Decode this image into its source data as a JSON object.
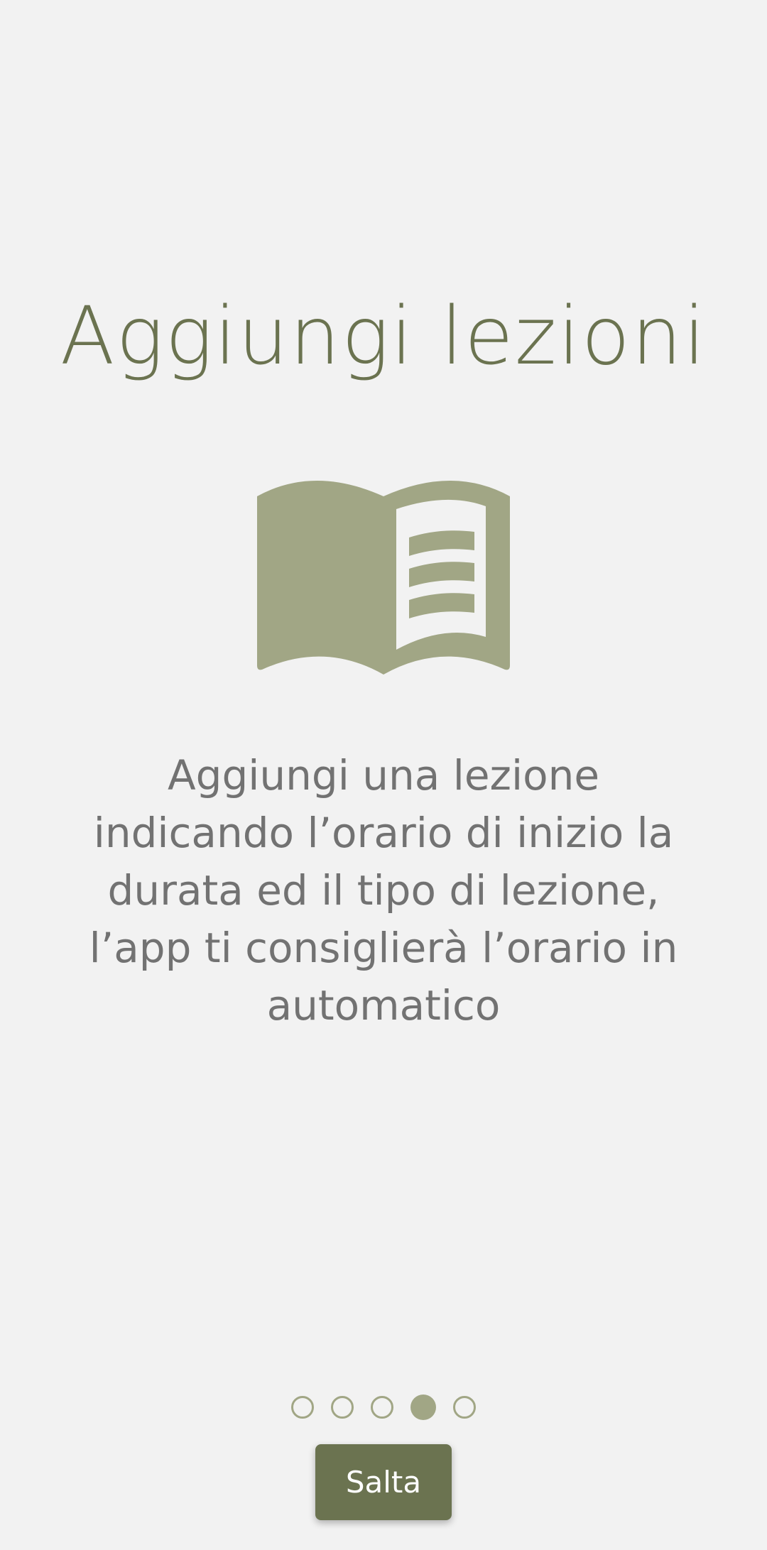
{
  "onboarding": {
    "title": "Aggiungi lezioni",
    "icon": "open-book-icon",
    "description": "Aggiungi una lezione indicando l’orario di inizio la durata ed il tipo di lezione, l’app ti consiglierà l’orario in automatico",
    "pages_total": 5,
    "current_page": 4,
    "skip_label": "Salta"
  },
  "colors": {
    "background": "#f2f2f2",
    "title": "#6b7350",
    "icon": "#a1a685",
    "description_text": "#727272",
    "button_background": "#6b7350",
    "button_text": "#ffffff",
    "dot": "#a1a685"
  }
}
